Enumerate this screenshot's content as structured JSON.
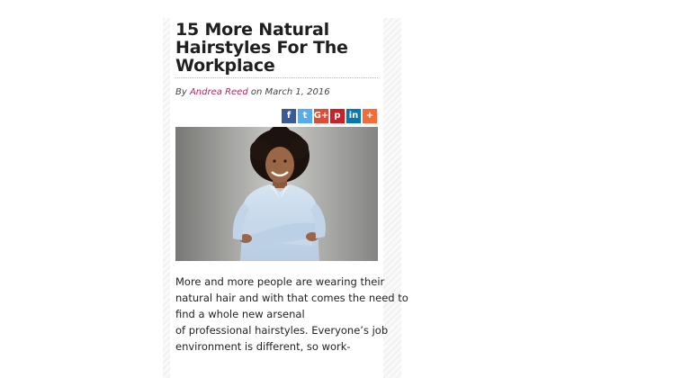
{
  "article": {
    "title_lines": [
      "15 More Natural",
      "Hairstyles For The",
      "Workplace"
    ],
    "byline": {
      "prefix": "By",
      "author": "Andrea Reed",
      "middle": "on",
      "date": "March 1, 2016"
    },
    "share_buttons": [
      {
        "name": "facebook",
        "glyph": "f",
        "color": "#3b5998"
      },
      {
        "name": "twitter",
        "glyph": "t",
        "color": "#55acee"
      },
      {
        "name": "google-plus",
        "glyph": "G+",
        "color": "#dd4b39"
      },
      {
        "name": "pinterest",
        "glyph": "p",
        "color": "#cb2027"
      },
      {
        "name": "linkedin",
        "glyph": "in",
        "color": "#0976b4"
      },
      {
        "name": "more",
        "glyph": "+",
        "color": "#f26c3a"
      }
    ],
    "body_lines": [
      "More and more people are wearing their",
      "natural hair and with that comes the need to",
      "find a whole new arsenal",
      "of professional hairstyles. Everyone’s job",
      "environment is different, so work-"
    ]
  },
  "colors": {
    "link": "#b3245f",
    "title": "#1f1f1f",
    "text": "#222222"
  }
}
